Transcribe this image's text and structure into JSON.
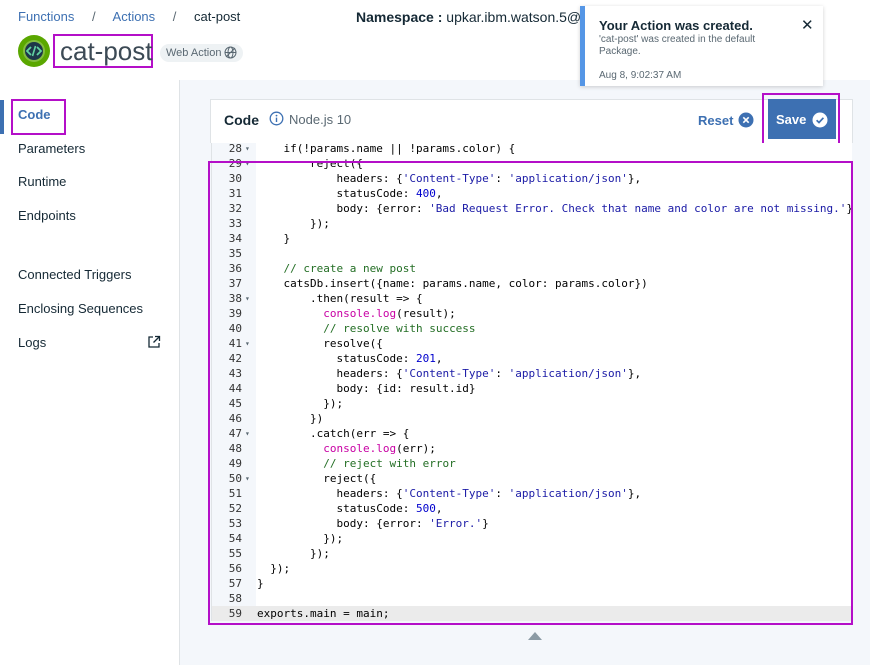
{
  "breadcrumb": {
    "items": [
      "Functions",
      "Actions"
    ],
    "separator": "/",
    "current": "cat-post"
  },
  "namespace": {
    "label": "Namespace :",
    "value": "upkar.ibm.watson.5@g"
  },
  "action": {
    "title": "cat-post",
    "badge": "Web Action"
  },
  "sidebar": {
    "items": [
      {
        "label": "Code",
        "active": true
      },
      {
        "label": "Parameters"
      },
      {
        "label": "Runtime"
      },
      {
        "label": "Endpoints"
      },
      {
        "label": "Connected Triggers"
      },
      {
        "label": "Enclosing Sequences"
      },
      {
        "label": "Logs"
      }
    ]
  },
  "code_panel": {
    "title": "Code",
    "runtime": "Node.js 10",
    "reset_label": "Reset",
    "save_label": "Save"
  },
  "editor": {
    "current_line": 59,
    "lines": [
      {
        "n": 28,
        "fold": true,
        "text": "    if(!params.name || !params.color) {"
      },
      {
        "n": 29,
        "fold": true,
        "text": "        reject({"
      },
      {
        "n": 30,
        "text": "            headers: {'Content-Type': 'application/json'},"
      },
      {
        "n": 31,
        "text": "            statusCode: 400,"
      },
      {
        "n": 32,
        "text": "            body: {error: 'Bad Request Error. Check that name and color are not missing.'}"
      },
      {
        "n": 33,
        "text": "        });"
      },
      {
        "n": 34,
        "text": "    }"
      },
      {
        "n": 35,
        "text": ""
      },
      {
        "n": 36,
        "text": "    // create a new post"
      },
      {
        "n": 37,
        "text": "    catsDb.insert({name: params.name, color: params.color})"
      },
      {
        "n": 38,
        "fold": true,
        "text": "        .then(result => {"
      },
      {
        "n": 39,
        "text": "          console.log(result);"
      },
      {
        "n": 40,
        "text": "          // resolve with success"
      },
      {
        "n": 41,
        "fold": true,
        "text": "          resolve({"
      },
      {
        "n": 42,
        "text": "            statusCode: 201,"
      },
      {
        "n": 43,
        "text": "            headers: {'Content-Type': 'application/json'},"
      },
      {
        "n": 44,
        "text": "            body: {id: result.id}"
      },
      {
        "n": 45,
        "text": "          });"
      },
      {
        "n": 46,
        "text": "        })"
      },
      {
        "n": 47,
        "fold": true,
        "text": "        .catch(err => {"
      },
      {
        "n": 48,
        "text": "          console.log(err);"
      },
      {
        "n": 49,
        "text": "          // reject with error"
      },
      {
        "n": 50,
        "fold": true,
        "text": "          reject({"
      },
      {
        "n": 51,
        "text": "            headers: {'Content-Type': 'application/json'},"
      },
      {
        "n": 52,
        "text": "            statusCode: 500,"
      },
      {
        "n": 53,
        "text": "            body: {error: 'Error.'}"
      },
      {
        "n": 54,
        "text": "          });"
      },
      {
        "n": 55,
        "text": "        });"
      },
      {
        "n": 56,
        "text": "  });"
      },
      {
        "n": 57,
        "text": "}"
      },
      {
        "n": 58,
        "text": ""
      },
      {
        "n": 59,
        "text": "exports.main = main;"
      }
    ]
  },
  "notification": {
    "title": "Your Action was created.",
    "message": "'cat-post' was created in the default Package.",
    "time": "Aug 8, 9:02:37 AM"
  },
  "colors": {
    "accent": "#3d70b2",
    "highlight_box": "#b40fc8",
    "logo": "#5aa700",
    "toast_border": "#5596e6"
  }
}
